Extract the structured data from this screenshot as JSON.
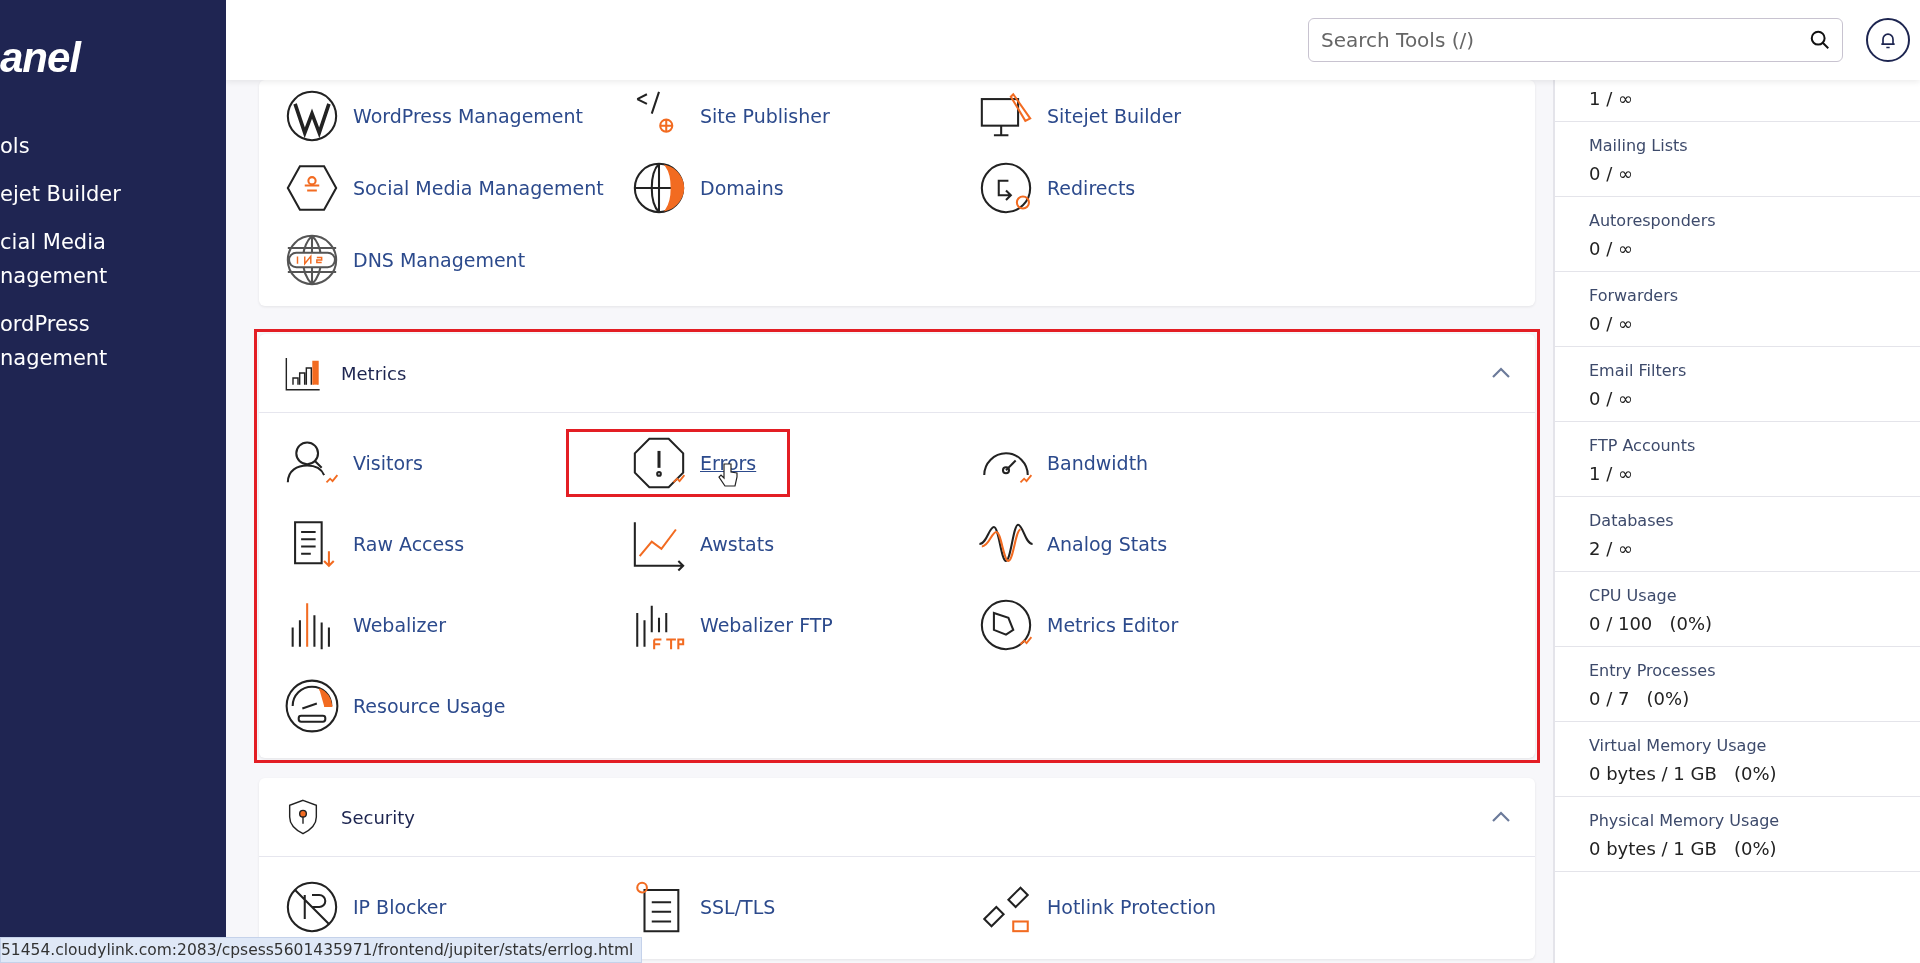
{
  "sidebar": {
    "logo": "anel",
    "items": [
      {
        "label": "ols"
      },
      {
        "label": "ejet Builder"
      },
      {
        "label": "cial Media nagement"
      },
      {
        "label": "ordPress nagement"
      }
    ]
  },
  "header": {
    "search": {
      "placeholder": "Search Tools (/)"
    }
  },
  "sections": [
    {
      "highlighted": false,
      "tools": [
        {
          "label": "WordPress Management",
          "highlighted": false,
          "hovered": false
        },
        {
          "label": "Site Publisher",
          "highlighted": false,
          "hovered": false
        },
        {
          "label": "Sitejet Builder",
          "highlighted": false,
          "hovered": false
        },
        {
          "label": "Social Media Management",
          "highlighted": false,
          "hovered": false
        },
        {
          "label": "Domains",
          "highlighted": false,
          "hovered": false
        },
        {
          "label": "Redirects",
          "highlighted": false,
          "hovered": false
        },
        {
          "label": "DNS Management",
          "highlighted": false,
          "hovered": false
        }
      ]
    },
    {
      "title": "Metrics",
      "expanded": true,
      "highlighted": true,
      "tools": [
        {
          "label": "Visitors",
          "highlighted": false,
          "hovered": false
        },
        {
          "label": "Errors",
          "highlighted": true,
          "hovered": true
        },
        {
          "label": "Bandwidth",
          "highlighted": false,
          "hovered": false
        },
        {
          "label": "Raw Access",
          "highlighted": false,
          "hovered": false
        },
        {
          "label": "Awstats",
          "highlighted": false,
          "hovered": false
        },
        {
          "label": "Analog Stats",
          "highlighted": false,
          "hovered": false
        },
        {
          "label": "Webalizer",
          "highlighted": false,
          "hovered": false
        },
        {
          "label": "Webalizer FTP",
          "highlighted": false,
          "hovered": false
        },
        {
          "label": "Metrics Editor",
          "highlighted": false,
          "hovered": false
        },
        {
          "label": "Resource Usage",
          "highlighted": false,
          "hovered": false
        }
      ]
    },
    {
      "title": "Security",
      "expanded": true,
      "highlighted": false,
      "tools": [
        {
          "label": "IP Blocker",
          "highlighted": false,
          "hovered": false
        },
        {
          "label": "SSL/TLS",
          "highlighted": false,
          "hovered": false
        },
        {
          "label": "Hotlink Protection",
          "highlighted": false,
          "hovered": false
        }
      ]
    }
  ],
  "stats": [
    {
      "value": "1 / ∞"
    },
    {
      "label": "Mailing Lists",
      "value": "0 / ∞"
    },
    {
      "label": "Autoresponders",
      "value": "0 / ∞"
    },
    {
      "label": "Forwarders",
      "value": "0 / ∞"
    },
    {
      "label": "Email Filters",
      "value": "0 / ∞"
    },
    {
      "label": "FTP Accounts",
      "value": "1 / ∞"
    },
    {
      "label": "Databases",
      "value": "2 / ∞"
    },
    {
      "label": "CPU Usage",
      "value": "0 / 100   (0%)"
    },
    {
      "label": "Entry Processes",
      "value": "0 / 7   (0%)"
    },
    {
      "label": "Virtual Memory Usage",
      "value": "0 bytes / 1 GB   (0%)"
    },
    {
      "label": "Physical Memory Usage",
      "value": "0 bytes / 1 GB   (0%)"
    }
  ],
  "status_url": "51454.cloudylink.com:2083/cpsess5601435971/frontend/jupiter/stats/errlog.html"
}
